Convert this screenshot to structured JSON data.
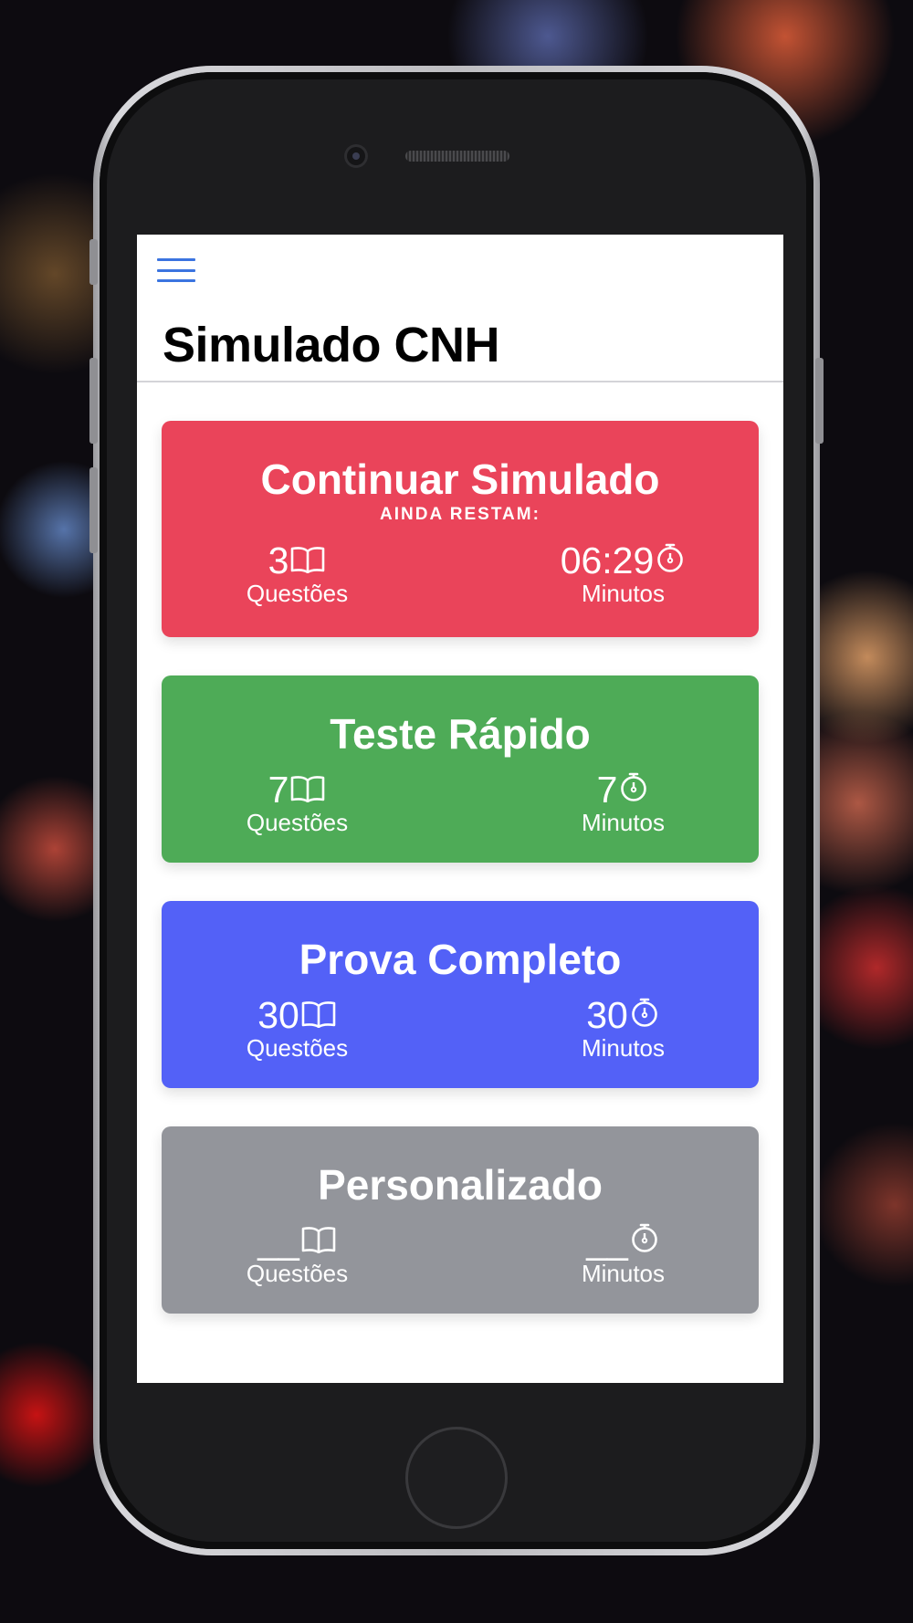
{
  "app": {
    "title": "Simulado CNH"
  },
  "colors": {
    "accent": "#3b74e0",
    "continue_card": "#ea445a",
    "quick_card": "#4eab57",
    "full_card": "#5361f7",
    "custom_card": "#93959b"
  },
  "cards": [
    {
      "title": "Continuar Simulado",
      "subtitle": "AINDA RESTAM:",
      "questions_value": "3",
      "questions_label": "Questões",
      "questions_icon": "book-open-icon",
      "time_value": "06:29",
      "time_label": "Minutos",
      "time_icon": "stopwatch-icon"
    },
    {
      "title": "Teste Rápido",
      "questions_value": "7",
      "questions_label": "Questões",
      "questions_icon": "book-open-icon",
      "time_value": "7",
      "time_label": "Minutos",
      "time_icon": "stopwatch-icon"
    },
    {
      "title": "Prova Completo",
      "questions_value": "30",
      "questions_label": "Questões",
      "questions_icon": "book-open-icon",
      "time_value": "30",
      "time_label": "Minutos",
      "time_icon": "stopwatch-icon"
    },
    {
      "title": "Personalizado",
      "questions_value": "__",
      "questions_label": "Questões",
      "questions_icon": "book-open-icon",
      "time_value": "__",
      "time_label": "Minutos",
      "time_icon": "stopwatch-icon"
    }
  ]
}
